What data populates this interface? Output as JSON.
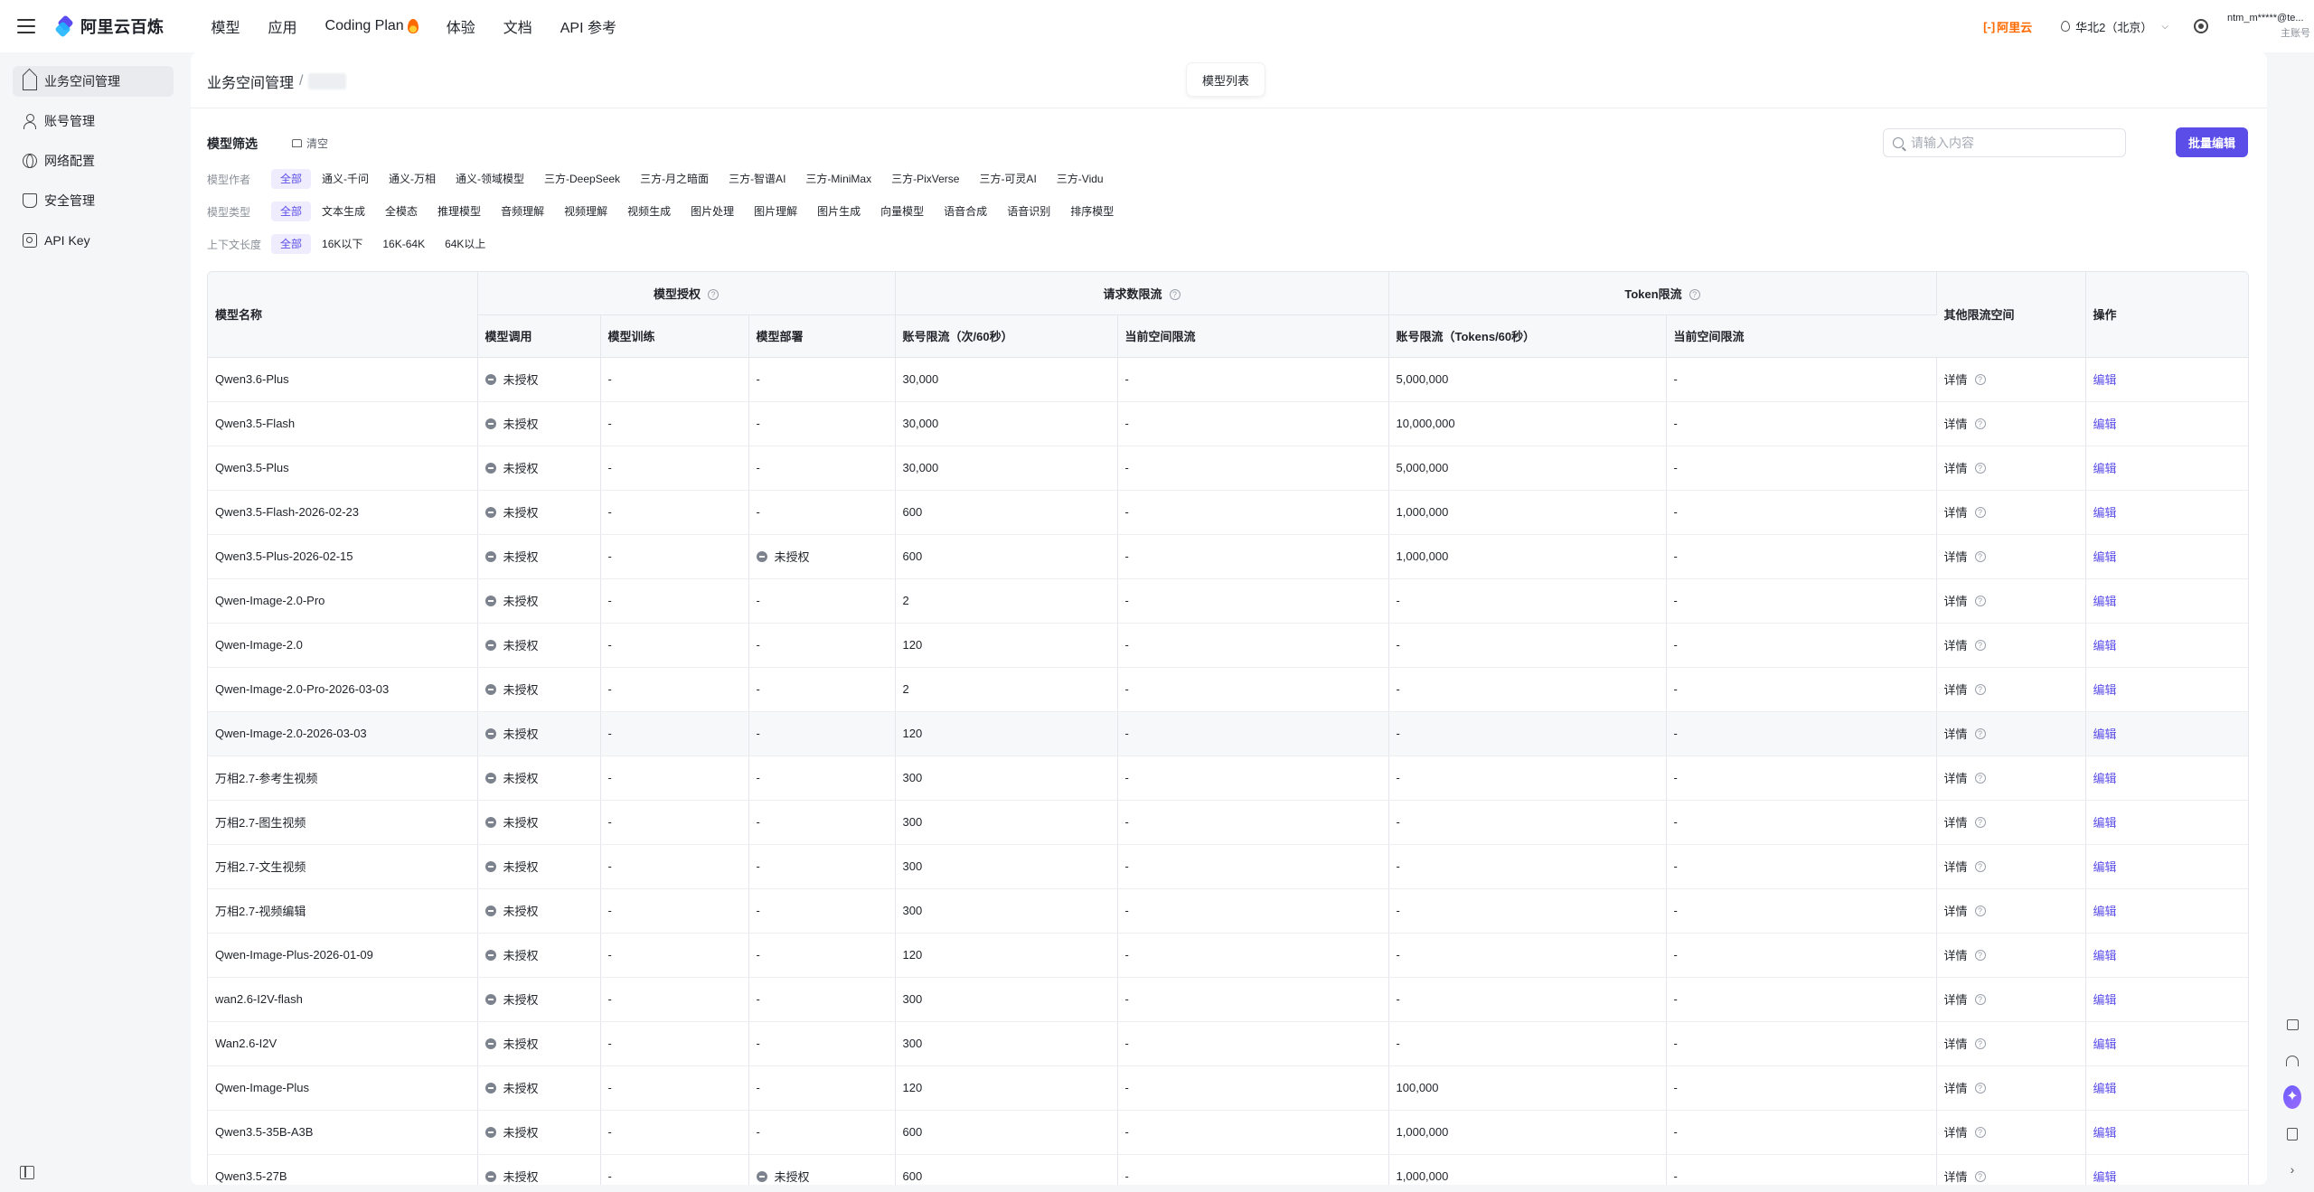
{
  "app": {
    "logo_text": "阿里云百炼",
    "nav": [
      "模型",
      "应用",
      "Coding Plan",
      "体验",
      "文档",
      "API 参考"
    ],
    "brand": "阿里云",
    "region": "华北2（北京）",
    "account_name": "ntm_m*****@te...",
    "account_role": "主账号"
  },
  "sidebar": {
    "items": [
      {
        "label": "业务空间管理",
        "icon": "home-icon"
      },
      {
        "label": "账号管理",
        "icon": "user-icon"
      },
      {
        "label": "网络配置",
        "icon": "globe-icon"
      },
      {
        "label": "安全管理",
        "icon": "shield-icon"
      },
      {
        "label": "API Key",
        "icon": "key-icon"
      }
    ]
  },
  "header": {
    "breadcrumb_root": "业务空间管理",
    "breadcrumb_sep": "/",
    "tab_label": "模型列表"
  },
  "filters": {
    "title": "模型筛选",
    "clear_label": "清空",
    "search_placeholder": "请输入内容",
    "batch_edit_label": "批量编辑",
    "author": {
      "label": "模型作者",
      "options": [
        "全部",
        "通义-千问",
        "通义-万相",
        "通义-领域模型",
        "三方-DeepSeek",
        "三方-月之暗面",
        "三方-智谱AI",
        "三方-MiniMax",
        "三方-PixVerse",
        "三方-可灵AI",
        "三方-Vidu"
      ]
    },
    "type": {
      "label": "模型类型",
      "options": [
        "全部",
        "文本生成",
        "全模态",
        "推理模型",
        "音频理解",
        "视频理解",
        "视频生成",
        "图片处理",
        "图片理解",
        "图片生成",
        "向量模型",
        "语音合成",
        "语音识别",
        "排序模型"
      ]
    },
    "context": {
      "label": "上下文长度",
      "options": [
        "全部",
        "16K以下",
        "16K-64K",
        "64K以上"
      ]
    }
  },
  "table": {
    "group_headers": {
      "model_name": "模型名称",
      "model_auth": "模型授权",
      "request_limit": "请求数限流",
      "token_limit": "Token限流",
      "other_limit": "其他限流空间",
      "action": "操作"
    },
    "sub_headers": {
      "invoke": "模型调用",
      "training": "模型训练",
      "deploy": "模型部署",
      "account_rpm": "账号限流（次/60秒）",
      "space_rpm": "当前空间限流",
      "account_tpm": "账号限流（Tokens/60秒）",
      "space_tpm": "当前空间限流"
    },
    "rows": [
      {
        "name": "Qwen3.6-Plus",
        "invoke": "未授权",
        "training": "-",
        "deploy": "-",
        "rpm": "30,000",
        "space_rpm": "-",
        "tpm": "5,000,000",
        "space_tpm": "-",
        "other": "详情",
        "action": "编辑"
      },
      {
        "name": "Qwen3.5-Flash",
        "invoke": "未授权",
        "training": "-",
        "deploy": "-",
        "rpm": "30,000",
        "space_rpm": "-",
        "tpm": "10,000,000",
        "space_tpm": "-",
        "other": "详情",
        "action": "编辑"
      },
      {
        "name": "Qwen3.5-Plus",
        "invoke": "未授权",
        "training": "-",
        "deploy": "-",
        "rpm": "30,000",
        "space_rpm": "-",
        "tpm": "5,000,000",
        "space_tpm": "-",
        "other": "详情",
        "action": "编辑"
      },
      {
        "name": "Qwen3.5-Flash-2026-02-23",
        "invoke": "未授权",
        "training": "-",
        "deploy": "-",
        "rpm": "600",
        "space_rpm": "-",
        "tpm": "1,000,000",
        "space_tpm": "-",
        "other": "详情",
        "action": "编辑"
      },
      {
        "name": "Qwen3.5-Plus-2026-02-15",
        "invoke": "未授权",
        "training": "-",
        "deploy": "未授权",
        "rpm": "600",
        "space_rpm": "-",
        "tpm": "1,000,000",
        "space_tpm": "-",
        "other": "详情",
        "action": "编辑"
      },
      {
        "name": "Qwen-Image-2.0-Pro",
        "invoke": "未授权",
        "training": "-",
        "deploy": "-",
        "rpm": "2",
        "space_rpm": "-",
        "tpm": "-",
        "space_tpm": "-",
        "other": "详情",
        "action": "编辑"
      },
      {
        "name": "Qwen-Image-2.0",
        "invoke": "未授权",
        "training": "-",
        "deploy": "-",
        "rpm": "120",
        "space_rpm": "-",
        "tpm": "-",
        "space_tpm": "-",
        "other": "详情",
        "action": "编辑"
      },
      {
        "name": "Qwen-Image-2.0-Pro-2026-03-03",
        "invoke": "未授权",
        "training": "-",
        "deploy": "-",
        "rpm": "2",
        "space_rpm": "-",
        "tpm": "-",
        "space_tpm": "-",
        "other": "详情",
        "action": "编辑"
      },
      {
        "name": "Qwen-Image-2.0-2026-03-03",
        "invoke": "未授权",
        "training": "-",
        "deploy": "-",
        "rpm": "120",
        "space_rpm": "-",
        "tpm": "-",
        "space_tpm": "-",
        "other": "详情",
        "action": "编辑"
      },
      {
        "name": "万相2.7-参考生视频",
        "invoke": "未授权",
        "training": "-",
        "deploy": "-",
        "rpm": "300",
        "space_rpm": "-",
        "tpm": "-",
        "space_tpm": "-",
        "other": "详情",
        "action": "编辑"
      },
      {
        "name": "万相2.7-图生视频",
        "invoke": "未授权",
        "training": "-",
        "deploy": "-",
        "rpm": "300",
        "space_rpm": "-",
        "tpm": "-",
        "space_tpm": "-",
        "other": "详情",
        "action": "编辑"
      },
      {
        "name": "万相2.7-文生视频",
        "invoke": "未授权",
        "training": "-",
        "deploy": "-",
        "rpm": "300",
        "space_rpm": "-",
        "tpm": "-",
        "space_tpm": "-",
        "other": "详情",
        "action": "编辑"
      },
      {
        "name": "万相2.7-视频编辑",
        "invoke": "未授权",
        "training": "-",
        "deploy": "-",
        "rpm": "300",
        "space_rpm": "-",
        "tpm": "-",
        "space_tpm": "-",
        "other": "详情",
        "action": "编辑"
      },
      {
        "name": "Qwen-Image-Plus-2026-01-09",
        "invoke": "未授权",
        "training": "-",
        "deploy": "-",
        "rpm": "120",
        "space_rpm": "-",
        "tpm": "-",
        "space_tpm": "-",
        "other": "详情",
        "action": "编辑"
      },
      {
        "name": "wan2.6-I2V-flash",
        "invoke": "未授权",
        "training": "-",
        "deploy": "-",
        "rpm": "300",
        "space_rpm": "-",
        "tpm": "-",
        "space_tpm": "-",
        "other": "详情",
        "action": "编辑"
      },
      {
        "name": "Wan2.6-I2V",
        "invoke": "未授权",
        "training": "-",
        "deploy": "-",
        "rpm": "300",
        "space_rpm": "-",
        "tpm": "-",
        "space_tpm": "-",
        "other": "详情",
        "action": "编辑"
      },
      {
        "name": "Qwen-Image-Plus",
        "invoke": "未授权",
        "training": "-",
        "deploy": "-",
        "rpm": "120",
        "space_rpm": "-",
        "tpm": "100,000",
        "space_tpm": "-",
        "other": "详情",
        "action": "编辑"
      },
      {
        "name": "Qwen3.5-35B-A3B",
        "invoke": "未授权",
        "training": "-",
        "deploy": "-",
        "rpm": "600",
        "space_rpm": "-",
        "tpm": "1,000,000",
        "space_tpm": "-",
        "other": "详情",
        "action": "编辑"
      },
      {
        "name": "Qwen3.5-27B",
        "invoke": "未授权",
        "training": "-",
        "deploy": "未授权",
        "rpm": "600",
        "space_rpm": "-",
        "tpm": "1,000,000",
        "space_tpm": "-",
        "other": "详情",
        "action": "编辑"
      }
    ]
  },
  "colors": {
    "accent": "#5b4de8",
    "brand_orange": "#ff6a00",
    "chip_active_bg": "#efedfd"
  }
}
